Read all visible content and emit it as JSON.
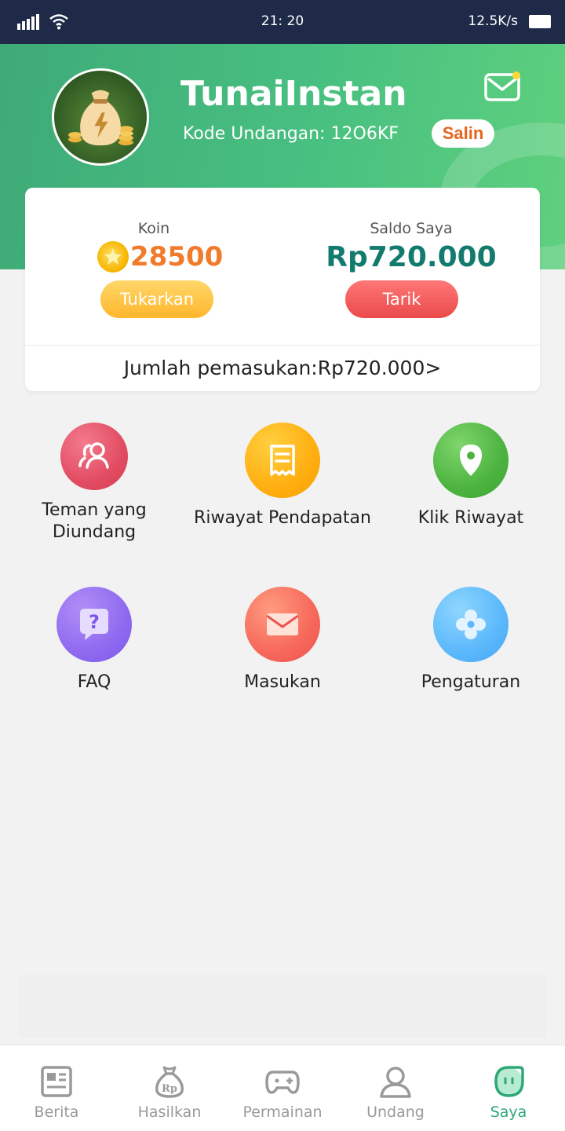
{
  "status_bar": {
    "time": "21: 20",
    "speed": "12.5K/s"
  },
  "header": {
    "username": "TunaiInstan",
    "invite_code": "Kode Undangan: 12O6KF",
    "copy_label": "Salin"
  },
  "card": {
    "coin_label": "Koin",
    "coin_value": "28500",
    "redeem_label": "Tukarkan",
    "balance_label": "Saldo Saya",
    "balance_value": "Rp720.000",
    "withdraw_label": "Tarik",
    "income_text": "Jumlah pemasukan:Rp720.000>"
  },
  "menu": {
    "friends": "Teman yang Diundang",
    "income_history": "Riwayat Pendapatan",
    "click_history": "Klik Riwayat",
    "faq": "FAQ",
    "feedback": "Masukan",
    "settings": "Pengaturan"
  },
  "nav": {
    "news": "Berita",
    "earn": "Hasilkan",
    "games": "Permainan",
    "invite": "Undang",
    "me": "Saya"
  },
  "colors": {
    "accent_green": "#2ea876",
    "coin_orange": "#f17b2a",
    "balance_teal": "#137a6e"
  }
}
